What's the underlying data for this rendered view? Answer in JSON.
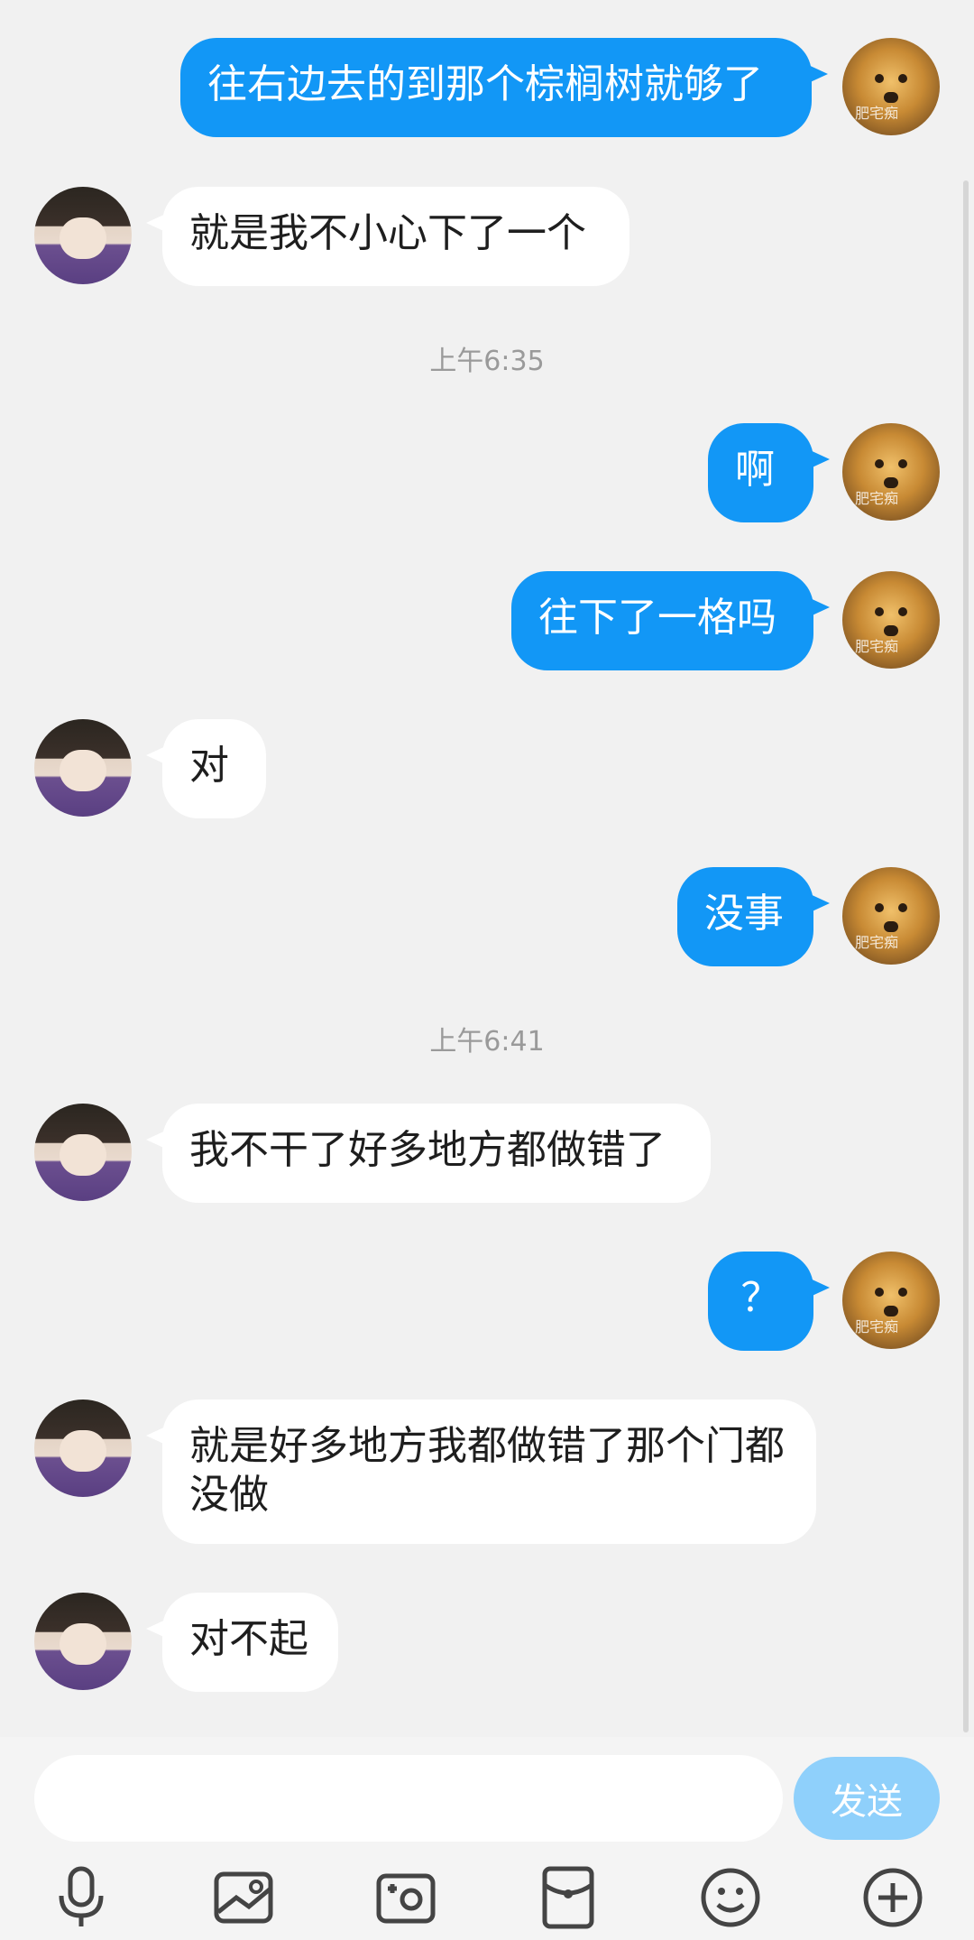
{
  "messages": [
    {
      "dir": "out",
      "text": "往右边去的到那个棕榈树就够了"
    },
    {
      "dir": "in",
      "text": "就是我不小心下了一个"
    },
    {
      "dir": "out",
      "text": "啊"
    },
    {
      "dir": "out",
      "text": "往下了一格吗"
    },
    {
      "dir": "in",
      "text": "对"
    },
    {
      "dir": "out",
      "text": "没事"
    },
    {
      "dir": "out",
      "text": "？"
    },
    {
      "dir": "in",
      "text": "就是好多地方我都做错了那个门都没做"
    },
    {
      "dir": "in",
      "text": "对不起"
    },
    {
      "dir": "in",
      "text": "我不干了好多地方都做错了"
    }
  ],
  "timestamps": [
    "上午6:35",
    "上午6:41"
  ],
  "avatar_watermark": "肥宅痴",
  "composer": {
    "input_value": "",
    "send_label": "发送"
  },
  "toolbar": [
    "microphone-icon",
    "image-icon",
    "camera-icon",
    "red-packet-icon",
    "emoji-icon",
    "plus-icon"
  ],
  "colors": {
    "outgoing_bubble": "#1297f6",
    "incoming_bubble": "#ffffff",
    "background": "#f1f1f1",
    "send_button": "#8fd0fb"
  }
}
